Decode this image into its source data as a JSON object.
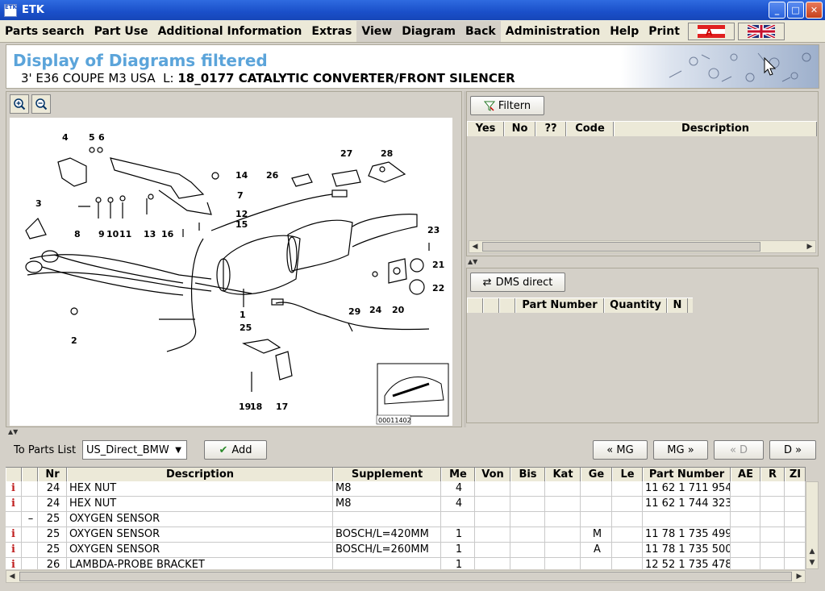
{
  "window": {
    "title": "ETK",
    "icon_text": "ETK"
  },
  "menu": {
    "items": [
      "Parts search",
      "Part Use",
      "Additional Information",
      "Extras",
      "View",
      "Diagram",
      "Back",
      "Administration",
      "Help",
      "Print"
    ],
    "highlighted": [
      "View",
      "Diagram",
      "Back"
    ]
  },
  "header": {
    "title": "Display of Diagrams filtered",
    "model": "3' E36 COUPE M3 USA",
    "l_label": "L:",
    "group": "18_0177 CATALYTIC CONVERTER/FRONT SILENCER"
  },
  "diagram": {
    "image_code": "00011402",
    "callouts": [
      "4",
      "5",
      "6",
      "3",
      "27",
      "28",
      "26",
      "14",
      "7",
      "12",
      "15",
      "8",
      "9",
      "10",
      "11",
      "13",
      "16",
      "23",
      "21",
      "22",
      "24",
      "20",
      "29",
      "2",
      "1",
      "25",
      "19",
      "18",
      "17"
    ]
  },
  "filter_panel": {
    "filter_button": "Filtern",
    "columns": [
      "Yes",
      "No",
      "??",
      "Code",
      "Description"
    ]
  },
  "dms_panel": {
    "dms_button": "DMS direct",
    "columns": [
      "",
      "",
      "",
      "Part Number",
      "Quantity",
      "N"
    ]
  },
  "parts": {
    "to_list_label": "To Parts List",
    "list_value": "US_Direct_BMW",
    "add_button": "Add",
    "nav": {
      "prev_mg": "« MG",
      "next_mg": "MG »",
      "prev_d": "« D",
      "next_d": "D »"
    },
    "columns": [
      "",
      "",
      "Nr",
      "Description",
      "Supplement",
      "Me",
      "Von",
      "Bis",
      "Kat",
      "Ge",
      "Le",
      "Part Number",
      "AE",
      "R",
      "ZI"
    ],
    "rows": [
      {
        "info": "i",
        "mark": "",
        "nr": "24",
        "desc": "HEX NUT",
        "supp": "M8",
        "me": "4",
        "von": "",
        "bis": "",
        "kat": "",
        "ge": "",
        "le": "",
        "pn": "11 62 1 711 954",
        "ae": "",
        "r": "",
        "zi": ""
      },
      {
        "info": "i",
        "mark": "",
        "nr": "24",
        "desc": "HEX NUT",
        "supp": "M8",
        "me": "4",
        "von": "",
        "bis": "",
        "kat": "",
        "ge": "",
        "le": "",
        "pn": "11 62 1 744 323",
        "ae": "",
        "r": "",
        "zi": ""
      },
      {
        "info": "",
        "mark": "–",
        "nr": "25",
        "desc": "OXYGEN SENSOR",
        "supp": "",
        "me": "",
        "von": "",
        "bis": "",
        "kat": "",
        "ge": "",
        "le": "",
        "pn": "",
        "ae": "",
        "r": "",
        "zi": ""
      },
      {
        "info": "i",
        "mark": "",
        "nr": "25",
        "desc": "OXYGEN SENSOR",
        "supp": "BOSCH/L=420MM",
        "me": "1",
        "von": "",
        "bis": "",
        "kat": "",
        "ge": "M",
        "le": "",
        "pn": "11 78 1 735 499",
        "ae": "",
        "r": "",
        "zi": ""
      },
      {
        "info": "i",
        "mark": "",
        "nr": "25",
        "desc": "OXYGEN SENSOR",
        "supp": "BOSCH/L=260MM",
        "me": "1",
        "von": "",
        "bis": "",
        "kat": "",
        "ge": "A",
        "le": "",
        "pn": "11 78 1 735 500",
        "ae": "",
        "r": "",
        "zi": ""
      },
      {
        "info": "i",
        "mark": "",
        "nr": "26",
        "desc": "LAMBDA-PROBE BRACKET",
        "supp": "",
        "me": "1",
        "von": "",
        "bis": "",
        "kat": "",
        "ge": "",
        "le": "",
        "pn": "12 52 1 735 478",
        "ae": "",
        "r": "",
        "zi": ""
      }
    ]
  }
}
